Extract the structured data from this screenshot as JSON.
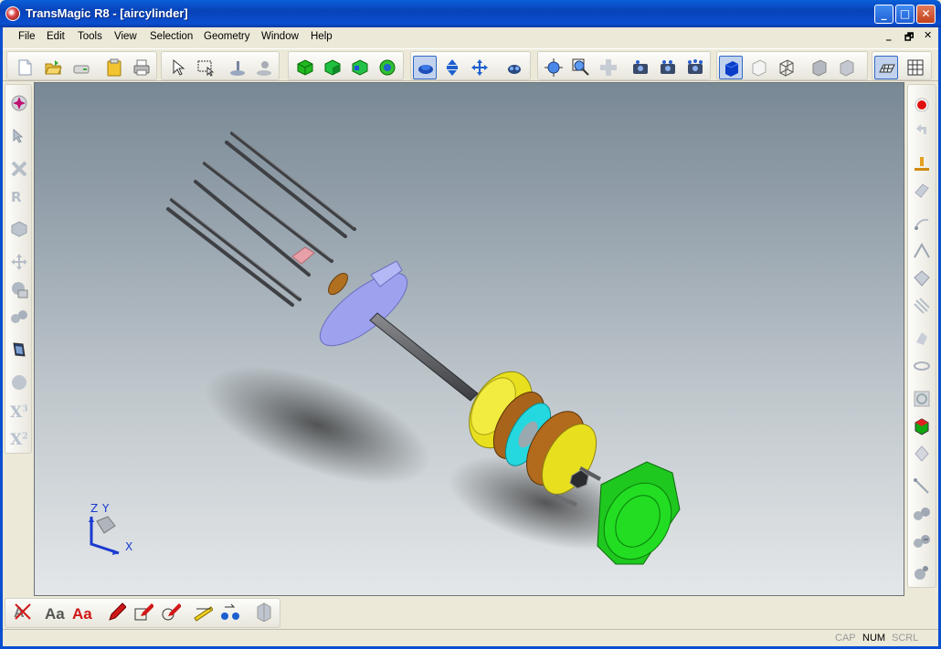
{
  "window": {
    "title": "TransMagic R8 - [aircylinder]",
    "controls": {
      "minimize": "_",
      "maximize": "□",
      "close": "✕"
    },
    "mdi_controls": {
      "minimize": "_",
      "restore": "🗗",
      "close": "✕"
    }
  },
  "menu": {
    "file": "File",
    "edit": "Edit",
    "tools": "Tools",
    "view": "View",
    "selection": "Selection",
    "geometry": "Geometry",
    "window": "Window",
    "help": "Help"
  },
  "toolbar_top": {
    "icons": [
      "new-file-icon",
      "open-folder-icon",
      "save-drive-icon",
      "paste-clipboard-icon",
      "print-icon",
      "select-arrow-icon",
      "box-select-icon",
      "pick-icon",
      "pick-gray-icon",
      "solid-view-icon",
      "shade-view-icon",
      "hidden-view-icon",
      "outline-view-icon",
      "rotate-view-icon",
      "pan-view-icon",
      "move-axes-icon",
      "fit-view-icon",
      "zoom-window-icon",
      "zoom-area-icon",
      "zoom-cross-icon",
      "camera-icon",
      "camera-two-icon",
      "camera-three-icon",
      "shaded-cube-icon",
      "white-cube-icon",
      "wireframe-cube-icon",
      "gray-cube-icon",
      "gray-cube-two-icon",
      "grid-plane-icon",
      "grid-table-icon"
    ]
  },
  "viewport": {
    "triad": {
      "z": "Z",
      "y": "Y",
      "x": "X"
    },
    "background": "#8f9ca6"
  },
  "toolbar_bottom": {
    "aa_label": "Aa",
    "aa_red_label": "Aa"
  },
  "left_toolbar": {
    "x3": "X",
    "x3_sup": "3",
    "x2": "X",
    "x2_sup": "2"
  },
  "statusbar": {
    "cap": "CAP",
    "num": "NUM",
    "scrl": "SCRL"
  },
  "colors": {
    "xp_blue": "#0a4fd0",
    "part_yellow": "#e8e01e",
    "part_green": "#22dd22",
    "part_lavender": "#9ea2ee",
    "part_cyan": "#25d8e0",
    "part_brown": "#b26a1c"
  }
}
